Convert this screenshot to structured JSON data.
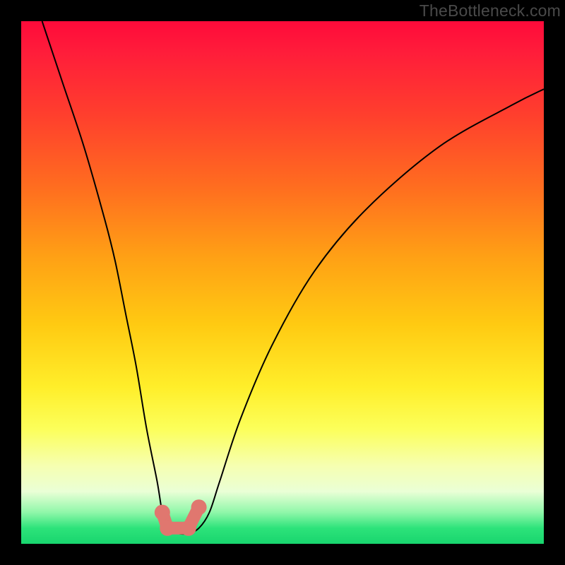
{
  "watermark": "TheBottleneck.com",
  "colors": {
    "frame_bg": "#000000",
    "curve_stroke": "#000000",
    "node_fill": "#e0776f",
    "gradient_stops": [
      "#ff0a3a",
      "#ff6e1f",
      "#ffca12",
      "#fcff5a",
      "#2de37a"
    ]
  },
  "chart_data": {
    "type": "line",
    "title": "",
    "xlabel": "",
    "ylabel": "",
    "xlim": [
      0,
      100
    ],
    "ylim": [
      0,
      100
    ],
    "grid": false,
    "legend": false,
    "note": "x and y are in percent of the plot area; y=0 is bottom. Values are estimated from pixels — no numeric ticks are shown in the image so units are relative.",
    "series": [
      {
        "name": "bottleneck-curve",
        "x": [
          4,
          8,
          12,
          16,
          18,
          20,
          22,
          24,
          26,
          27,
          28,
          30,
          32,
          34,
          36,
          38,
          42,
          48,
          56,
          66,
          80,
          94,
          100
        ],
        "y": [
          100,
          88,
          76,
          62,
          54,
          44,
          34,
          22,
          12,
          6,
          3,
          2,
          2,
          3,
          6,
          12,
          24,
          38,
          52,
          64,
          76,
          84,
          87
        ]
      }
    ],
    "markers": [
      {
        "name": "trough-left",
        "x": 27,
        "y": 6
      },
      {
        "name": "trough-mid-l",
        "x": 28,
        "y": 3
      },
      {
        "name": "trough-mid-r",
        "x": 32,
        "y": 3
      },
      {
        "name": "trough-right",
        "x": 34,
        "y": 7
      }
    ],
    "marker_connector": {
      "from": 0,
      "to": 3,
      "note": "thick round bar joining the trough markers"
    }
  }
}
